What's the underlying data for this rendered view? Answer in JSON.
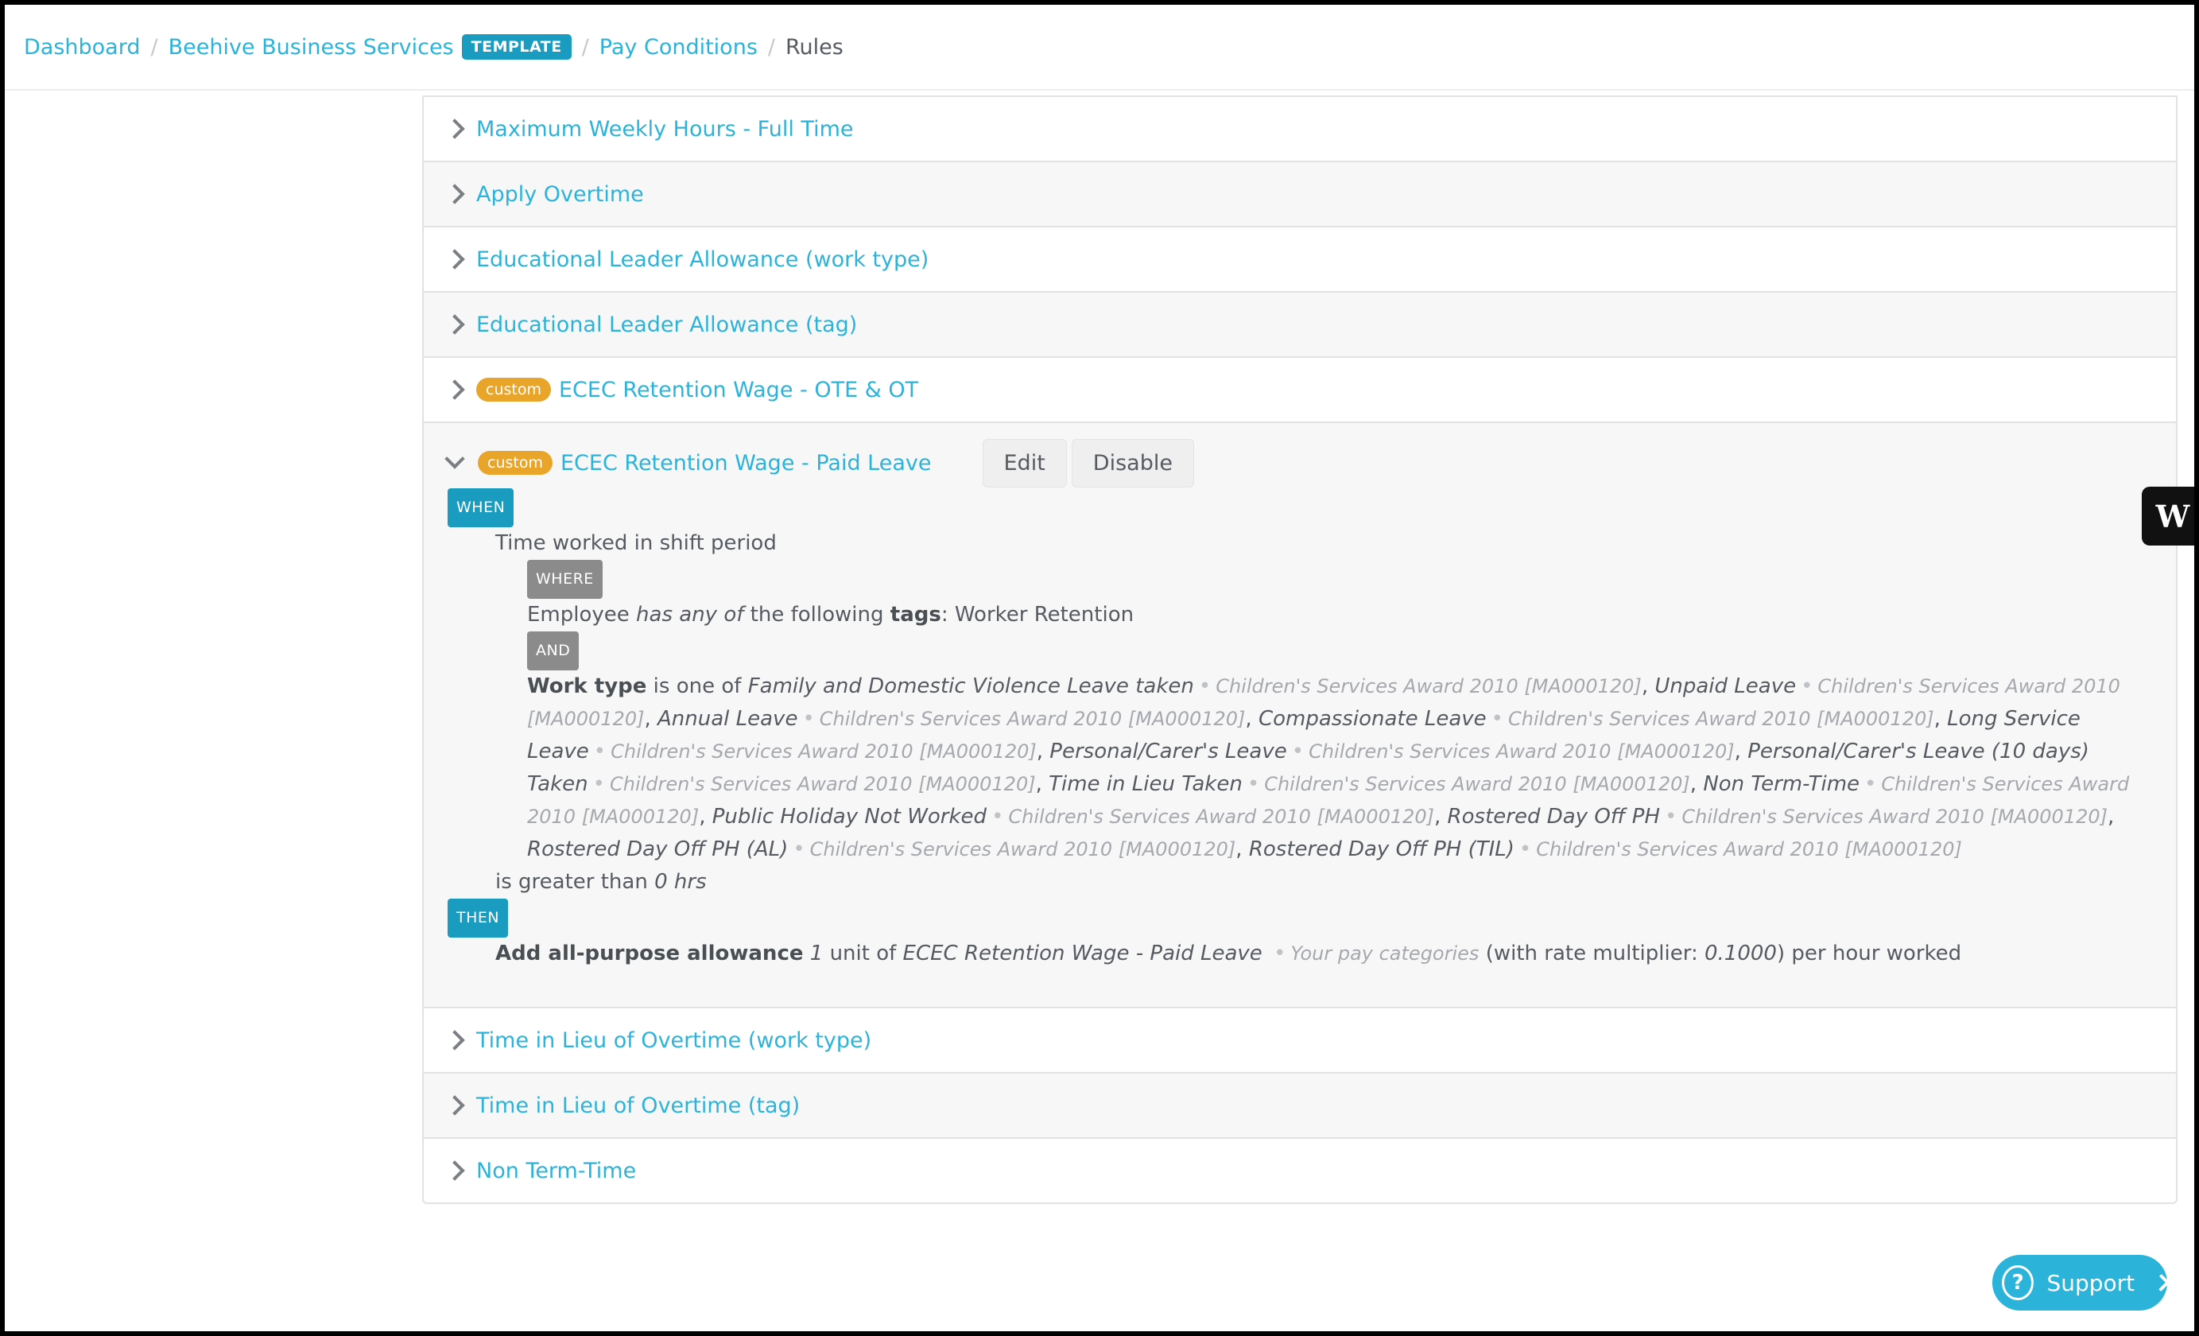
{
  "breadcrumb": {
    "dashboard": "Dashboard",
    "business": "Beehive Business Services",
    "template_badge": "TEMPLATE",
    "pay_conditions": "Pay Conditions",
    "current": "Rules"
  },
  "rules_before": [
    {
      "name": "Maximum Weekly Hours - Full Time"
    },
    {
      "name": "Apply Overtime"
    },
    {
      "name": "Educational Leader Allowance (work type)"
    },
    {
      "name": "Educational Leader Allowance (tag)"
    },
    {
      "name": "ECEC Retention Wage - OTE & OT",
      "badge": "custom"
    }
  ],
  "expanded_rule": {
    "badge": "custom",
    "name": "ECEC Retention Wage - Paid Leave",
    "edit_label": "Edit",
    "disable_label": "Disable",
    "when_label": "WHEN",
    "when_subject": "Time worked in shift period",
    "where_label": "WHERE",
    "where_subject": "Employee",
    "where_op": "has any of",
    "where_mid": "the following",
    "where_key": "tags",
    "where_value": ": Worker Retention",
    "and_label": "AND",
    "worktype_key": "Work type",
    "worktype_op": "is one of",
    "award": "Children's Services Award 2010 [MA000120]",
    "work_types": [
      "Family and Domestic Violence Leave taken",
      "Unpaid Leave",
      "Annual Leave",
      "Compassionate Leave",
      "Long Service Leave",
      "Personal/Carer's Leave",
      "Personal/Carer's Leave (10 days) Taken",
      "Time in Lieu Taken",
      "Non Term-Time",
      "Public Holiday Not Worked",
      "Rostered Day Off PH",
      "Rostered Day Off PH (AL)",
      "Rostered Day Off PH (TIL)"
    ],
    "condition_op": "is greater than",
    "condition_value": "0 hrs",
    "then_label": "THEN",
    "action": "Add all-purpose allowance",
    "units": "1",
    "unit_of": "unit of",
    "pay_item": "ECEC Retention Wage - Paid Leave",
    "pay_category_source": "Your pay categories",
    "multiplier_prefix": "(with rate multiplier:",
    "multiplier": "0.1000",
    "multiplier_suffix": ") per hour worked"
  },
  "rules_after": [
    {
      "name": "Time in Lieu of Overtime (work type)"
    },
    {
      "name": "Time in Lieu of Overtime (tag)"
    },
    {
      "name": "Non Term-Time"
    }
  ],
  "side_widget": {
    "letter": "W"
  },
  "support": {
    "label": "Support",
    "icon": "?"
  }
}
